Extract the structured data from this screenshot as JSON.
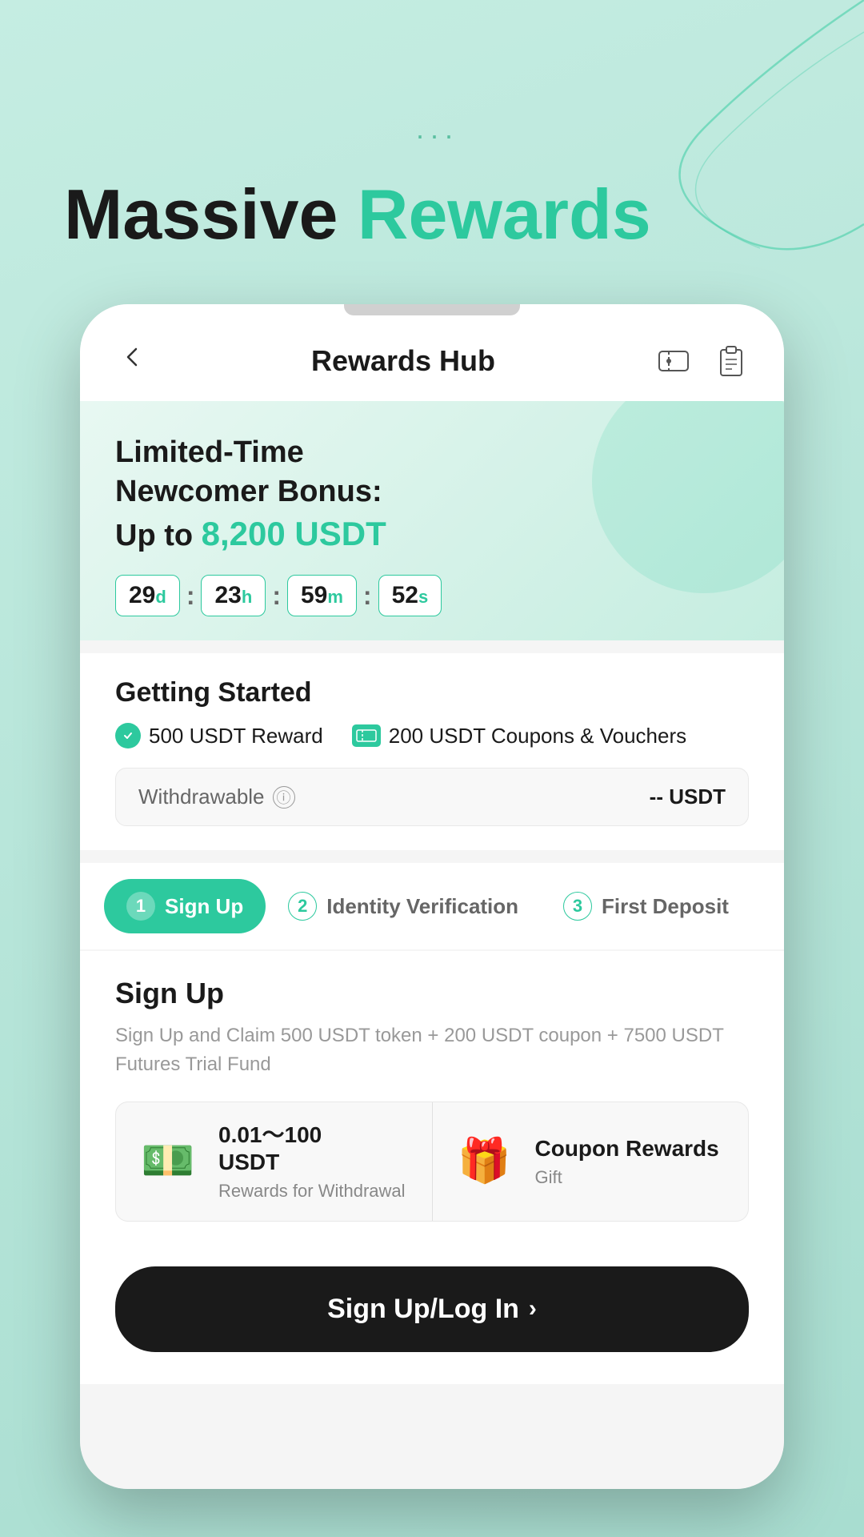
{
  "page": {
    "background_color": "#b2e8d8"
  },
  "headline": {
    "part1": "Massive ",
    "part2": "Rewards"
  },
  "dots": "...",
  "header": {
    "title": "Rewards Hub",
    "back_label": "←"
  },
  "banner": {
    "line1": "Limited-Time",
    "line2": "Newcomer Bonus:",
    "line3_prefix": "Up to ",
    "amount": "8,200 USDT",
    "countdown": {
      "days_value": "29",
      "days_unit": "d",
      "hours_value": "23",
      "hours_unit": "h",
      "minutes_value": "59",
      "minutes_unit": "m",
      "seconds_value": "52",
      "seconds_unit": "s"
    }
  },
  "getting_started": {
    "title": "Getting Started",
    "reward1": "500 USDT Reward",
    "reward2": "200 USDT Coupons & Vouchers",
    "withdrawable_label": "Withdrawable",
    "withdrawable_value": "-- USDT"
  },
  "steps": [
    {
      "number": "1",
      "label": "Sign Up",
      "active": true
    },
    {
      "number": "2",
      "label": "Identity Verification",
      "active": false
    },
    {
      "number": "3",
      "label": "First Deposit",
      "active": false
    }
  ],
  "signup_section": {
    "title": "Sign Up",
    "description": "Sign Up and Claim 500 USDT token + 200 USDT coupon + 7500 USDT Futures Trial Fund",
    "reward_card1": {
      "icon": "💵",
      "amount": "0.01～100\nUSDT",
      "sublabel": "Rewards for Withdrawal"
    },
    "reward_card2": {
      "icon": "🎁",
      "title": "Coupon Rewards",
      "sublabel": "Gift"
    }
  },
  "bottom_button": {
    "label": "Sign Up/Log In",
    "arrow": "›"
  }
}
